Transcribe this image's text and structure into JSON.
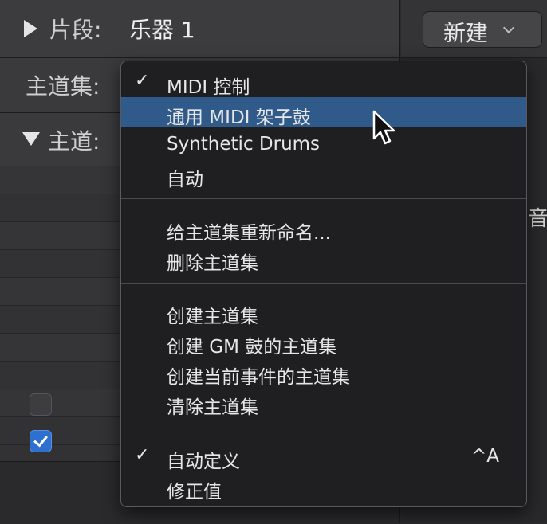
{
  "inspector": {
    "region_label": "片段:",
    "region_value": "乐器 1",
    "set_label": "主道集:",
    "lane_label": "主道:"
  },
  "toolbar": {
    "new_button_label": "新建"
  },
  "right_panel": {
    "partial_glyph": "音"
  },
  "menu": {
    "items": [
      {
        "label": "MIDI 控制",
        "checked": true
      },
      {
        "label": "通用 MIDI 架子鼓",
        "highlighted": true
      },
      {
        "label": "Synthetic Drums"
      },
      {
        "label": "自动"
      },
      {
        "label": "给主道集重新命名..."
      },
      {
        "label": "删除主道集"
      },
      {
        "label": "创建主道集"
      },
      {
        "label": "创建 GM 鼓的主道集"
      },
      {
        "label": "创建当前事件的主道集"
      },
      {
        "label": "清除主道集"
      },
      {
        "label": "自动定义",
        "checked": true,
        "shortcut": "^A"
      },
      {
        "label": "修正值"
      }
    ],
    "check_glyph": "✓"
  },
  "table": {
    "row_glyphs": [
      "",
      "",
      "",
      "",
      "",
      "",
      "",
      "",
      "",
      ""
    ]
  },
  "colors": {
    "highlight": "#2f5a8a",
    "checkbox_on": "#2f6fcf"
  }
}
